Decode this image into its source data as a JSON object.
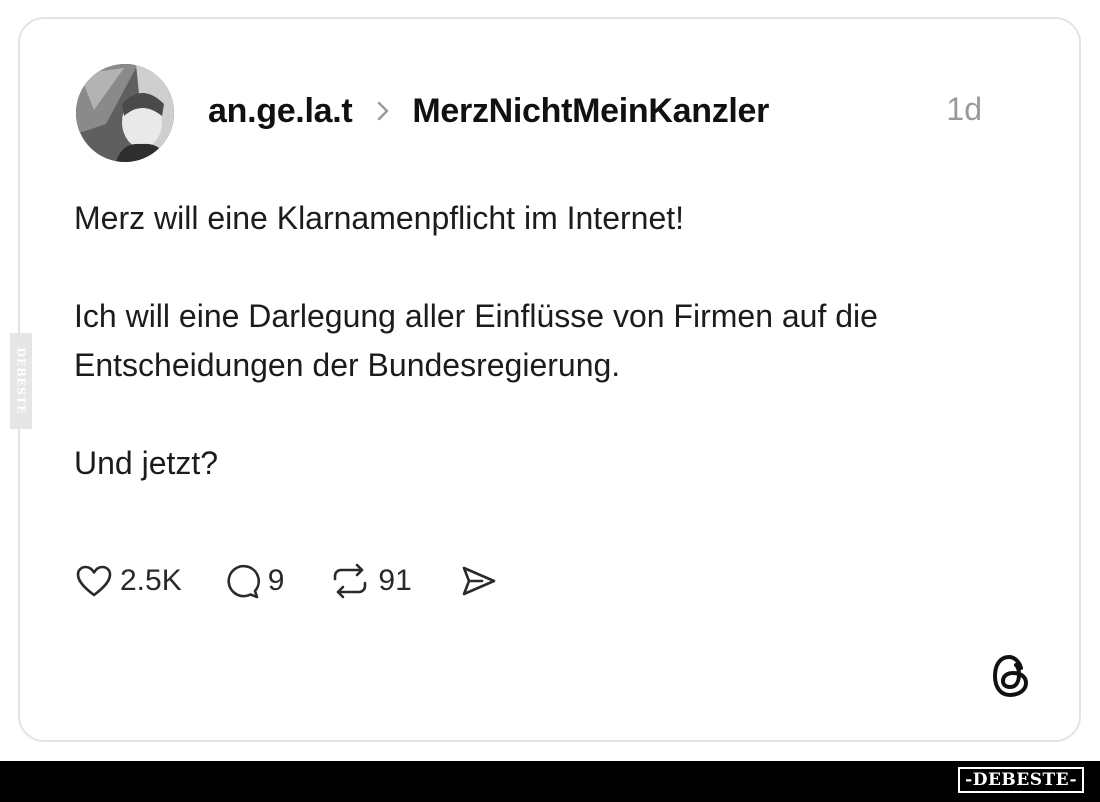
{
  "post": {
    "username": "an.ge.la.t",
    "topic": "MerzNichtMeinKanzler",
    "time": "1d",
    "paragraphs": [
      "Merz will eine Klarnamenpflicht im Internet!",
      "Ich will eine Darlegung aller Einflüsse von Firmen auf die Entscheidungen der Bundesregierung.",
      "Und jetzt?"
    ]
  },
  "actions": {
    "likes": "2.5K",
    "comments": "9",
    "reposts": "91"
  },
  "icons": {
    "like": "heart-icon",
    "comment": "comment-icon",
    "repost": "repost-icon",
    "share": "send-icon",
    "separator": "chevron-right-icon",
    "brand": "threads-logo-icon"
  },
  "watermark": {
    "side_text": "DEBESTE",
    "footer_text": "-DEBESTE-"
  },
  "colors": {
    "text": "#1c1c1c",
    "muted": "#9a9a9a",
    "card_border": "#e3e3e3",
    "footer_bg": "#000000"
  }
}
